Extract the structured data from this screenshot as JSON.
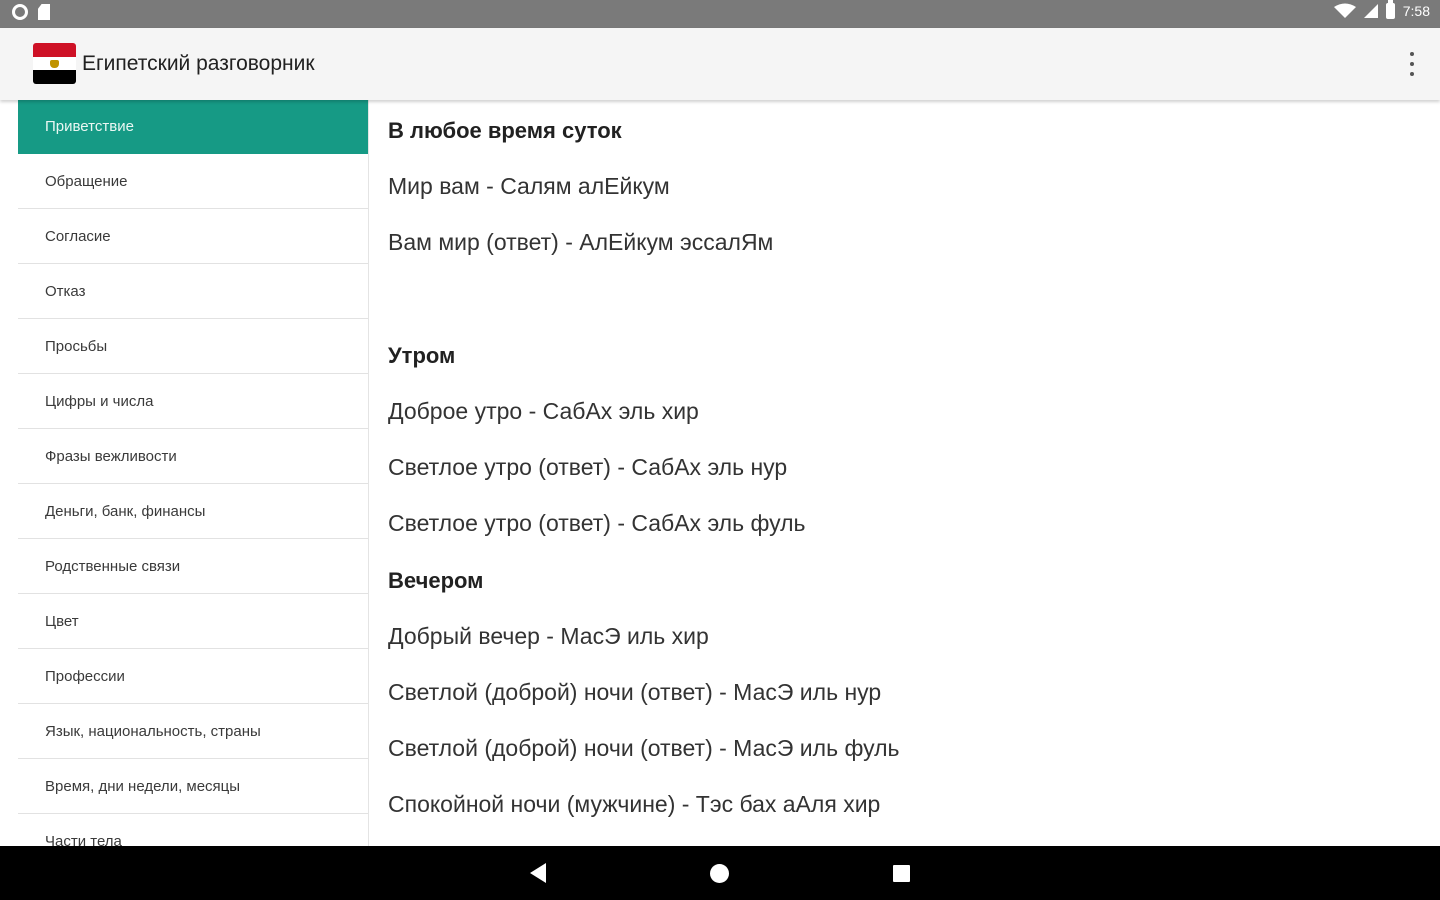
{
  "status_bar": {
    "time": "7:58",
    "icons": [
      "settings-icon",
      "sd-card-icon",
      "wifi-icon",
      "signal-icon",
      "battery-icon"
    ]
  },
  "app_bar": {
    "title": "Египетский разговорник",
    "logo": "egypt-flag-icon",
    "menu_icon": "more-vert-icon"
  },
  "sidebar": {
    "active_color": "#169a85",
    "items": [
      {
        "label": "Приветствие",
        "active": true
      },
      {
        "label": "Обращение"
      },
      {
        "label": "Согласие"
      },
      {
        "label": "Отказ"
      },
      {
        "label": "Просьбы"
      },
      {
        "label": "Цифры и числа"
      },
      {
        "label": "Фразы вежливости"
      },
      {
        "label": "Деньги, банк, финансы"
      },
      {
        "label": "Родственные связи"
      },
      {
        "label": "Цвет"
      },
      {
        "label": "Профессии"
      },
      {
        "label": "Язык, национальность, страны"
      },
      {
        "label": "Время, дни недели, месяцы"
      },
      {
        "label": "Части тела"
      }
    ]
  },
  "content": {
    "sections": [
      {
        "heading": "В любое время суток",
        "phrases": [
          "Мир вам - Салям алЕйкум",
          "Вам мир (ответ) - АлЕйкум эссалЯм"
        ]
      },
      {
        "heading": "Утром",
        "phrases": [
          "Доброе утро - СабАх эль хир",
          "Светлое утро (ответ) - СабАх эль нур",
          "Светлое утро (ответ) - СабАх эль фуль"
        ]
      },
      {
        "heading": "Вечером",
        "phrases": [
          "Добрый вечер - МасЭ иль хир",
          "Светлой (доброй) ночи (ответ) - МасЭ иль нур",
          "Светлой (доброй) ночи (ответ) - МасЭ иль фуль",
          "Спокойной ночи (мужчине) - Тэс бах аАля хир"
        ]
      }
    ]
  },
  "nav_bar": {
    "icons": [
      "back-icon",
      "home-icon",
      "recents-icon"
    ]
  }
}
